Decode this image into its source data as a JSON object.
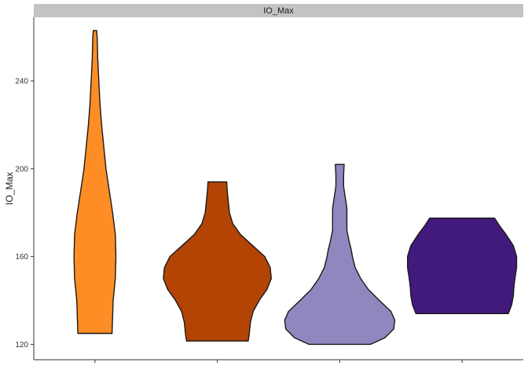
{
  "chart_data": {
    "type": "violin",
    "panel_title": "IO_Max",
    "xlabel": "",
    "ylabel": "IO_Max",
    "ylim": [
      113,
      269
    ],
    "y_ticks": [
      120,
      160,
      200,
      240
    ],
    "x_tick_labels": [
      "",
      "",
      "",
      ""
    ],
    "grid": false,
    "legend": "none",
    "series": [
      {
        "color": "#fd8d24",
        "profile": [
          [
            125,
            0.31
          ],
          [
            140,
            0.33
          ],
          [
            150,
            0.37
          ],
          [
            160,
            0.38
          ],
          [
            170,
            0.37
          ],
          [
            180,
            0.32
          ],
          [
            190,
            0.26
          ],
          [
            200,
            0.2
          ],
          [
            210,
            0.16
          ],
          [
            220,
            0.12
          ],
          [
            230,
            0.09
          ],
          [
            240,
            0.07
          ],
          [
            250,
            0.05
          ],
          [
            260,
            0.04
          ],
          [
            263,
            0.03
          ]
        ]
      },
      {
        "color": "#b34404",
        "profile": [
          [
            121.5,
            0.56
          ],
          [
            125,
            0.58
          ],
          [
            130,
            0.6
          ],
          [
            135,
            0.65
          ],
          [
            140,
            0.76
          ],
          [
            145,
            0.9
          ],
          [
            150,
            0.98
          ],
          [
            155,
            0.96
          ],
          [
            160,
            0.86
          ],
          [
            165,
            0.64
          ],
          [
            170,
            0.42
          ],
          [
            175,
            0.28
          ],
          [
            180,
            0.22
          ],
          [
            185,
            0.2
          ],
          [
            190,
            0.18
          ],
          [
            194,
            0.17
          ]
        ]
      },
      {
        "color": "#8f88bf",
        "profile": [
          [
            120,
            0.56
          ],
          [
            123,
            0.82
          ],
          [
            127,
            0.98
          ],
          [
            131,
            1.0
          ],
          [
            135,
            0.93
          ],
          [
            140,
            0.72
          ],
          [
            145,
            0.52
          ],
          [
            150,
            0.38
          ],
          [
            155,
            0.28
          ],
          [
            160,
            0.23
          ],
          [
            163,
            0.21
          ],
          [
            167,
            0.17
          ],
          [
            172,
            0.13
          ],
          [
            177,
            0.13
          ],
          [
            182,
            0.13
          ],
          [
            187,
            0.1
          ],
          [
            192,
            0.07
          ],
          [
            197,
            0.07
          ],
          [
            202,
            0.08
          ]
        ]
      },
      {
        "color": "#421a7c",
        "profile": [
          [
            134,
            0.84
          ],
          [
            138,
            0.9
          ],
          [
            142,
            0.93
          ],
          [
            146,
            0.94
          ],
          [
            150,
            0.96
          ],
          [
            155,
            0.99
          ],
          [
            160,
            0.99
          ],
          [
            165,
            0.93
          ],
          [
            170,
            0.8
          ],
          [
            174,
            0.68
          ],
          [
            177.5,
            0.59
          ]
        ]
      }
    ]
  }
}
